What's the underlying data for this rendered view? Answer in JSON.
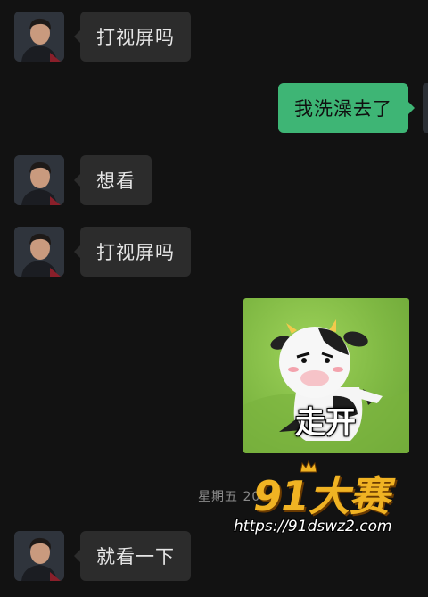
{
  "messages": [
    {
      "side": "left",
      "text": "打视屏吗"
    },
    {
      "side": "right",
      "text": "我洗澡去了"
    },
    {
      "side": "left",
      "text": "想看"
    },
    {
      "side": "left",
      "text": "打视屏吗"
    },
    {
      "side": "right",
      "type": "sticker",
      "caption": "走开",
      "icon": "cow-sticker"
    },
    {
      "side": "left",
      "text": "就看一下"
    }
  ],
  "timestamp": "星期五 20",
  "watermark": {
    "logo": "91大赛",
    "url": "https://91dswz2.com",
    "color": "#f0b323"
  },
  "colors": {
    "background": "#121212",
    "incoming_bubble": "#2c2c2c",
    "outgoing_bubble": "#3eb575"
  }
}
